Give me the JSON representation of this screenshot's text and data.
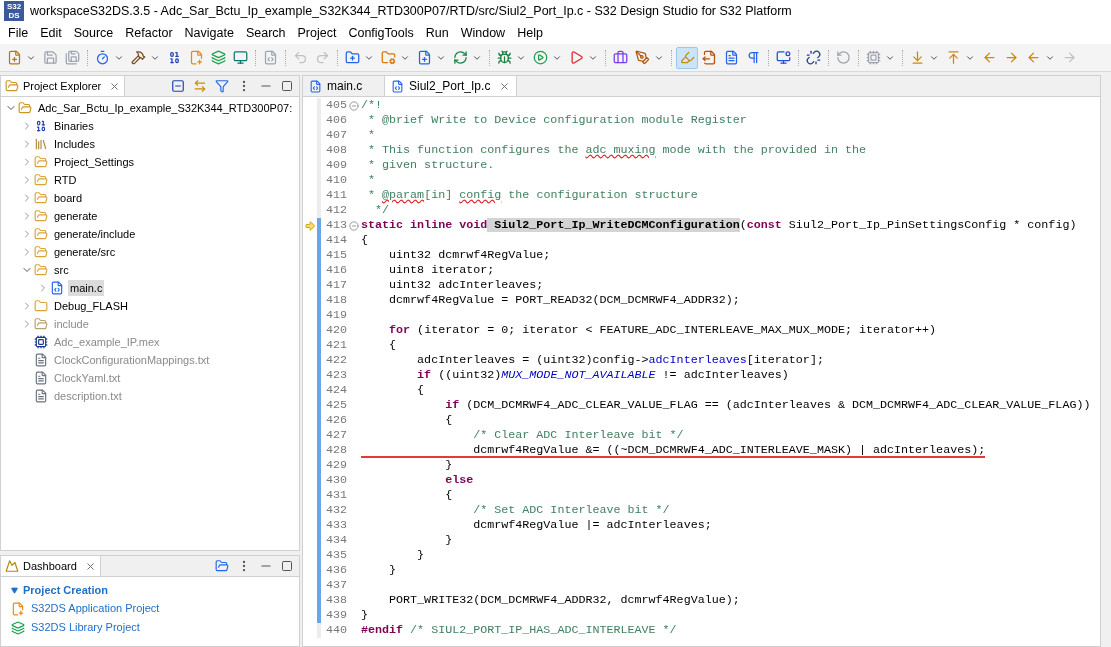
{
  "window": {
    "logo": [
      "S32",
      "DS"
    ],
    "title": "workspaceS32DS.3.5 - Adc_Sar_Bctu_Ip_example_S32K344_RTD300P07/RTD/src/Siul2_Port_Ip.c - S32 Design Studio for S32 Platform"
  },
  "menu": [
    "File",
    "Edit",
    "Source",
    "Refactor",
    "Navigate",
    "Search",
    "Project",
    "ConfigTools",
    "Run",
    "Window",
    "Help"
  ],
  "toolbar": {
    "mark_occurrences_on": true
  },
  "project_explorer": {
    "title": "Project Explorer",
    "tree": [
      {
        "label": "Adc_Sar_Bctu_Ip_example_S32K344_RTD300P07:",
        "kind": "project",
        "expanded": true,
        "selected": false,
        "greyed": false,
        "children": [
          {
            "label": "Binaries",
            "kind": "binaries",
            "expanded": false,
            "selected": false,
            "greyed": false
          },
          {
            "label": "Includes",
            "kind": "includes",
            "expanded": false,
            "selected": false,
            "greyed": false
          },
          {
            "label": "Project_Settings",
            "kind": "source-folder",
            "expanded": false,
            "selected": false,
            "greyed": false
          },
          {
            "label": "RTD",
            "kind": "source-folder",
            "expanded": false,
            "selected": false,
            "greyed": false
          },
          {
            "label": "board",
            "kind": "source-folder",
            "expanded": false,
            "selected": false,
            "greyed": false
          },
          {
            "label": "generate",
            "kind": "source-folder",
            "expanded": false,
            "selected": false,
            "greyed": false
          },
          {
            "label": "generate/include",
            "kind": "source-folder",
            "expanded": false,
            "selected": false,
            "greyed": false
          },
          {
            "label": "generate/src",
            "kind": "source-folder",
            "expanded": false,
            "selected": false,
            "greyed": false
          },
          {
            "label": "src",
            "kind": "source-folder",
            "expanded": true,
            "selected": false,
            "greyed": false,
            "children": [
              {
                "label": "main.c",
                "kind": "c-file",
                "expanded": false,
                "selected": true,
                "greyed": false
              }
            ]
          },
          {
            "label": "Debug_FLASH",
            "kind": "folder",
            "expanded": false,
            "selected": false,
            "greyed": false
          },
          {
            "label": "include",
            "kind": "excluded-folder",
            "expanded": false,
            "selected": false,
            "greyed": true
          },
          {
            "label": "Adc_example_IP.mex",
            "kind": "mex",
            "selected": false,
            "greyed": true
          },
          {
            "label": "ClockConfigurationMappings.txt",
            "kind": "text",
            "selected": false,
            "greyed": true
          },
          {
            "label": "ClockYaml.txt",
            "kind": "text",
            "selected": false,
            "greyed": true
          },
          {
            "label": "description.txt",
            "kind": "text",
            "selected": false,
            "greyed": true
          }
        ]
      }
    ]
  },
  "dashboard": {
    "title": "Dashboard",
    "section": {
      "title": "Project Creation",
      "expanded": true,
      "links": [
        {
          "label": "S32DS Application Project",
          "kind": "application"
        },
        {
          "label": "S32DS Library Project",
          "kind": "library"
        }
      ]
    }
  },
  "editor": {
    "tabs": [
      {
        "label": "main.c",
        "selected": false
      },
      {
        "label": "Siul2_Port_Ip.c",
        "selected": true
      }
    ],
    "lines": [
      {
        "n": "405",
        "fold": true,
        "changed": false,
        "tokens": [
          {
            "kind": "comment",
            "t": "/*!"
          }
        ]
      },
      {
        "n": "406",
        "changed": false,
        "tokens": [
          {
            "kind": "comment",
            "t": " * @brief Write to Device configuration module Register"
          }
        ]
      },
      {
        "n": "407",
        "changed": false,
        "tokens": [
          {
            "kind": "comment",
            "t": " *"
          }
        ]
      },
      {
        "n": "408",
        "changed": false,
        "tokens": [
          {
            "kind": "comment",
            "t": " * This function configures the "
          },
          {
            "kind": "misspelled",
            "t": "adc"
          },
          {
            "kind": "misspelled",
            "t": " muxing"
          },
          {
            "kind": "comment",
            "t": " mode with the provided in the"
          }
        ]
      },
      {
        "n": "409",
        "changed": false,
        "tokens": [
          {
            "kind": "comment",
            "t": " * given structure."
          }
        ]
      },
      {
        "n": "410",
        "changed": false,
        "tokens": [
          {
            "kind": "comment",
            "t": " *"
          }
        ]
      },
      {
        "n": "411",
        "changed": false,
        "tokens": [
          {
            "kind": "comment",
            "t": " * "
          },
          {
            "kind": "misspelled",
            "t": "@param"
          },
          {
            "kind": "comment",
            "t": "[in] "
          },
          {
            "kind": "misspelled",
            "t": "config"
          },
          {
            "kind": "comment",
            "t": " the configuration structure"
          }
        ]
      },
      {
        "n": "412",
        "changed": false,
        "tokens": [
          {
            "kind": "comment",
            "t": "  */"
          }
        ]
      },
      {
        "n": "413",
        "fold": true,
        "current": true,
        "changed": true,
        "tokens": [
          {
            "kind": "keyword",
            "t": "static inline void"
          },
          {
            "kind": "declaration",
            "t": " Siul2_Port_Ip_WriteDCMConfiguration"
          },
          {
            "kind": "plain",
            "t": "("
          },
          {
            "kind": "keyword",
            "t": "const"
          },
          {
            "kind": "plain",
            "t": " Siul2_Port_Ip_PinSettingsConfig * config)"
          }
        ]
      },
      {
        "n": "414",
        "changed": true,
        "tokens": [
          {
            "kind": "plain",
            "t": "{"
          }
        ]
      },
      {
        "n": "415",
        "changed": true,
        "tokens": [
          {
            "kind": "plain",
            "t": "    uint32 dcmrwf4RegValue;"
          }
        ]
      },
      {
        "n": "416",
        "changed": true,
        "tokens": [
          {
            "kind": "plain",
            "t": "    uint8 iterator;"
          }
        ]
      },
      {
        "n": "417",
        "changed": true,
        "tokens": [
          {
            "kind": "plain",
            "t": "    uint32 adcInterleaves;"
          }
        ]
      },
      {
        "n": "418",
        "changed": true,
        "tokens": [
          {
            "kind": "plain",
            "t": "    dcmrwf4RegValue = PORT_READ32(DCM_DCMRWF4_ADDR32);"
          }
        ]
      },
      {
        "n": "419",
        "changed": true
      },
      {
        "n": "420",
        "changed": true,
        "tokens": [
          {
            "kind": "keyword",
            "t": "    for"
          },
          {
            "kind": "plain",
            "t": " (iterator = 0; iterator < FEATURE_ADC_INTERLEAVE_MAX_MUX_MODE; iterator++)"
          }
        ]
      },
      {
        "n": "421",
        "changed": true,
        "tokens": [
          {
            "kind": "plain",
            "t": "    {"
          }
        ]
      },
      {
        "n": "422",
        "changed": true,
        "tokens": [
          {
            "kind": "plain",
            "t": "        adcInterleaves = (uint32)config->"
          },
          {
            "kind": "field",
            "t": "adcInterleaves"
          },
          {
            "kind": "plain",
            "t": "[iterator];"
          }
        ]
      },
      {
        "n": "423",
        "changed": true,
        "tokens": [
          {
            "kind": "keyword",
            "t": "        if"
          },
          {
            "kind": "plain",
            "t": " ((uint32)"
          },
          {
            "kind": "macro",
            "t": "MUX_MODE_NOT_AVAILABLE"
          },
          {
            "kind": "plain",
            "t": " != adcInterleaves)"
          }
        ]
      },
      {
        "n": "424",
        "changed": true,
        "tokens": [
          {
            "kind": "plain",
            "t": "        {"
          }
        ]
      },
      {
        "n": "425",
        "changed": true,
        "tokens": [
          {
            "kind": "keyword",
            "t": "            if"
          },
          {
            "kind": "plain",
            "t": " (DCM_DCMRWF4_ADC_CLEAR_VALUE_FLAG == (adcInterleaves & DCM_DCMRWF4_ADC_CLEAR_VALUE_FLAG))"
          }
        ]
      },
      {
        "n": "426",
        "changed": true,
        "tokens": [
          {
            "kind": "plain",
            "t": "            {"
          }
        ]
      },
      {
        "n": "427",
        "changed": true,
        "tokens": [
          {
            "kind": "comment",
            "t": "                /* Clear ADC Interleave bit */"
          }
        ]
      },
      {
        "n": "428",
        "changed": true,
        "underlined": true,
        "tokens": [
          {
            "kind": "plain",
            "t": "                dcmrwf4RegValue &= ((~DCM_DCMRWF4_ADC_INTERLEAVE_MASK) | adcInterleaves);"
          }
        ]
      },
      {
        "n": "429",
        "changed": true,
        "tokens": [
          {
            "kind": "plain",
            "t": "            }"
          }
        ]
      },
      {
        "n": "430",
        "changed": true,
        "tokens": [
          {
            "kind": "keyword",
            "t": "            else"
          }
        ]
      },
      {
        "n": "431",
        "changed": true,
        "tokens": [
          {
            "kind": "plain",
            "t": "            {"
          }
        ]
      },
      {
        "n": "432",
        "changed": true,
        "tokens": [
          {
            "kind": "comment",
            "t": "                /* Set ADC Interleave bit */"
          }
        ]
      },
      {
        "n": "433",
        "changed": true,
        "tokens": [
          {
            "kind": "plain",
            "t": "                dcmrwf4RegValue |= adcInterleaves;"
          }
        ]
      },
      {
        "n": "434",
        "changed": true,
        "tokens": [
          {
            "kind": "plain",
            "t": "            }"
          }
        ]
      },
      {
        "n": "435",
        "changed": true,
        "tokens": [
          {
            "kind": "plain",
            "t": "        }"
          }
        ]
      },
      {
        "n": "436",
        "changed": true,
        "tokens": [
          {
            "kind": "plain",
            "t": "    }"
          }
        ]
      },
      {
        "n": "437",
        "changed": true
      },
      {
        "n": "438",
        "changed": true,
        "tokens": [
          {
            "kind": "plain",
            "t": "    PORT_WRITE32(DCM_DCMRWF4_ADDR32, dcmrwf4RegValue);"
          }
        ]
      },
      {
        "n": "439",
        "changed": true,
        "tokens": [
          {
            "kind": "plain",
            "t": "}"
          }
        ]
      },
      {
        "n": "440",
        "changed": false,
        "tokens": [
          {
            "kind": "keyword",
            "t": "#endif"
          },
          {
            "kind": "comment",
            "t": " /* SIUL2_PORT_IP_HAS_ADC_INTERLEAVE */"
          }
        ]
      }
    ]
  }
}
